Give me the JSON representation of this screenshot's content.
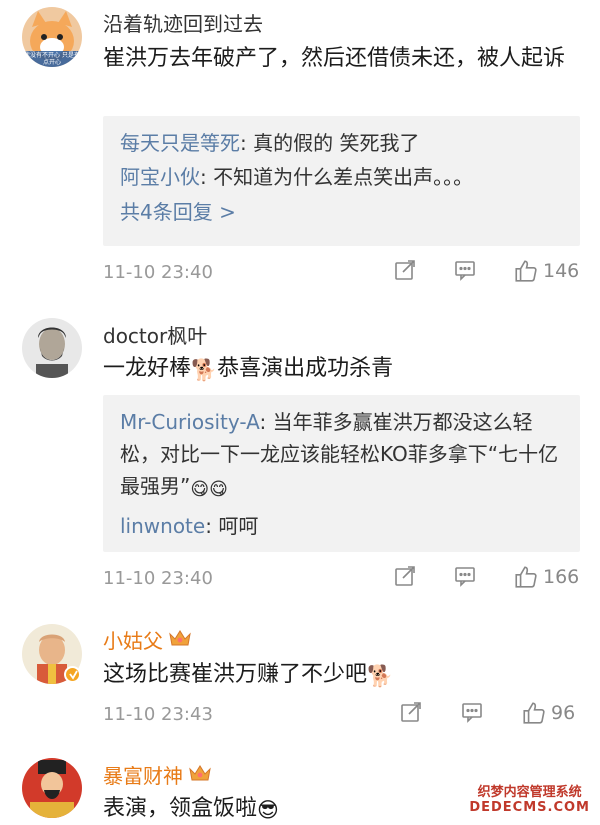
{
  "comments": [
    {
      "username": "沿着轨迹回到过去",
      "text": "崔洪万去年破产了，然后还借债未还，被人起诉",
      "replies": [
        {
          "user": "每天只是等死",
          "text": "真的假的 笑死我了"
        },
        {
          "user": "阿宝小伙",
          "text": "不知道为什么差点笑出声。。。"
        }
      ],
      "more_replies": "共4条回复 >",
      "time": "11-10 23:40",
      "likes": "146"
    },
    {
      "username": "doctor枫叶",
      "text_before": "一龙好棒",
      "emoji": "doge",
      "text_after": "恭喜演出成功杀青",
      "replies": [
        {
          "user": "Mr-Curiosity-A",
          "text_a": "当年菲多赢崔洪万都没这么轻松，对比一下一龙应该能轻松KO菲多拿下“七十亿最强男”"
        },
        {
          "user": "linwnote",
          "text": "呵呵"
        }
      ],
      "time": "11-10 23:40",
      "likes": "166"
    },
    {
      "username": "小姑父",
      "text": "这场比赛崔洪万赚了不少吧",
      "time": "11-10 23:43",
      "likes": "96"
    },
    {
      "username": "暴富财神",
      "text": "表演，领盒饭啦"
    }
  ],
  "avatar_text": "我没有不开心 只是有点开心",
  "watermark": {
    "line1": "织梦内容管理系统",
    "line2": "DEDECMS.COM"
  },
  "colors": {
    "link": "#5b7da6",
    "vip_name": "#e87b17",
    "reply_bg": "#f2f2f2",
    "meta": "#999999"
  },
  "icons": [
    "share-icon",
    "comment-icon",
    "like-icon",
    "crown-badge-icon",
    "verified-badge-icon"
  ]
}
